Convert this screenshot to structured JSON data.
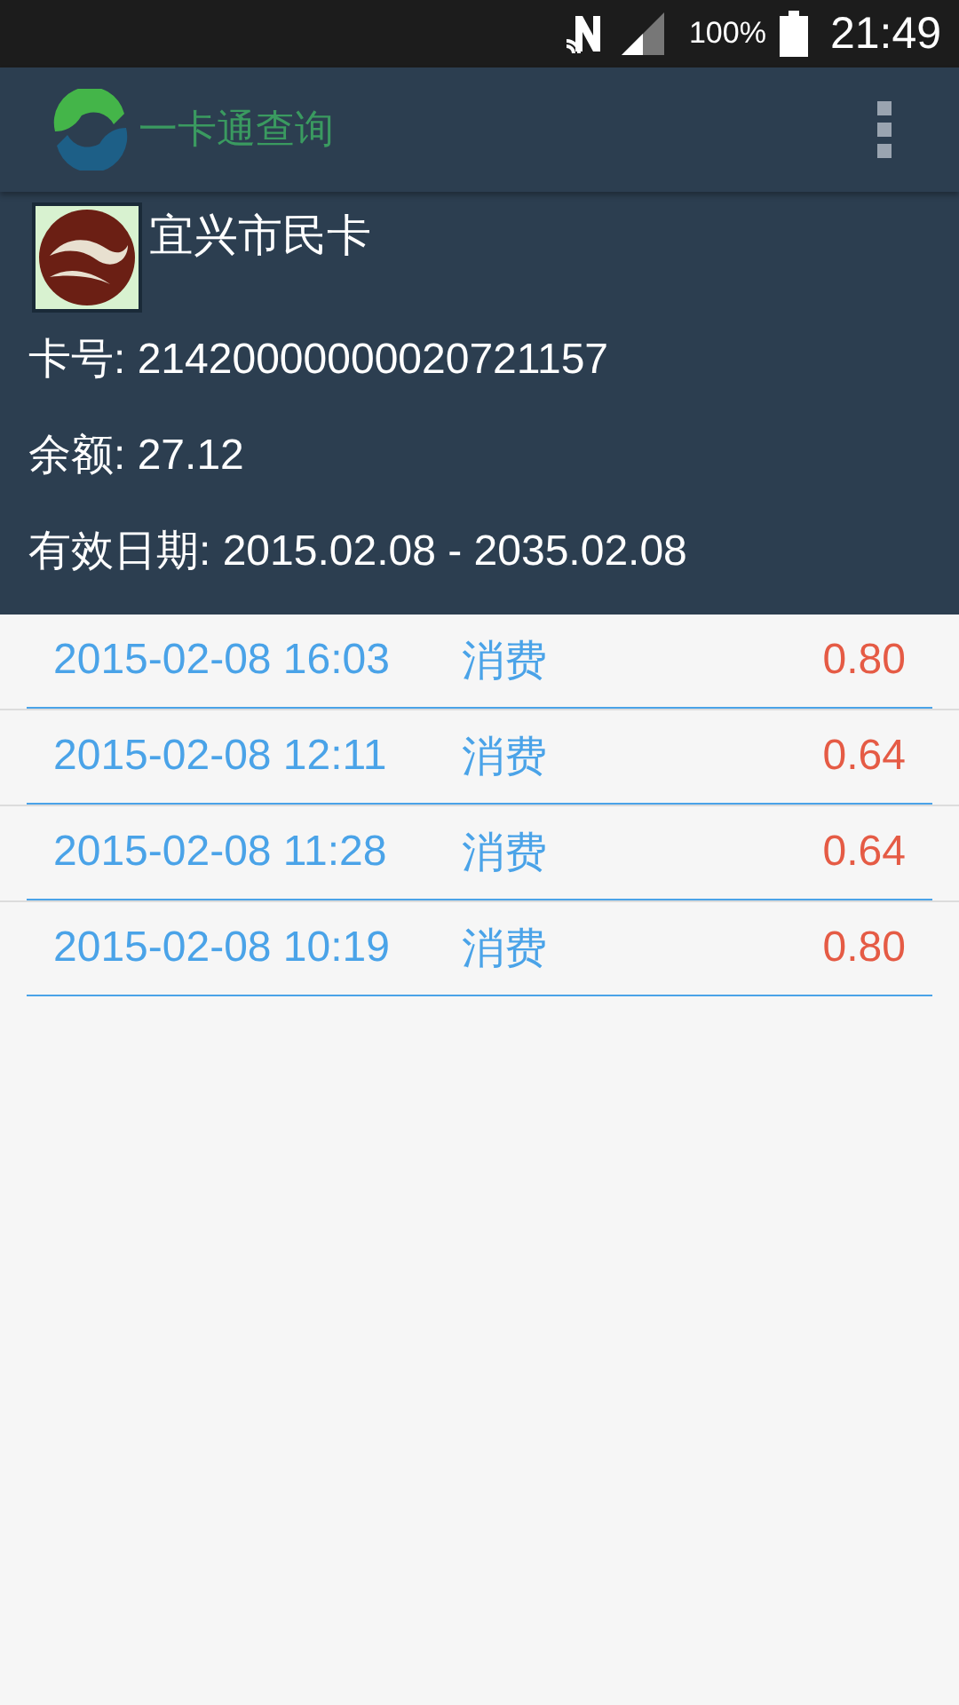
{
  "status_bar": {
    "battery": "100%",
    "time": "21:49"
  },
  "app_bar": {
    "title": "一卡通查询"
  },
  "card": {
    "name": "宜兴市民卡",
    "lines": [
      "卡号: 21420000000020721157",
      "余额: 27.12",
      "有效日期: 2015.02.08 - 2035.02.08"
    ]
  },
  "transactions": [
    {
      "time": "2015-02-08 16:03",
      "type": "消费",
      "amount": "0.80"
    },
    {
      "time": "2015-02-08 12:11",
      "type": "消费",
      "amount": "0.64"
    },
    {
      "time": "2015-02-08 11:28",
      "type": "消费",
      "amount": "0.64"
    },
    {
      "time": "2015-02-08 10:19",
      "type": "消费",
      "amount": "0.80"
    }
  ]
}
